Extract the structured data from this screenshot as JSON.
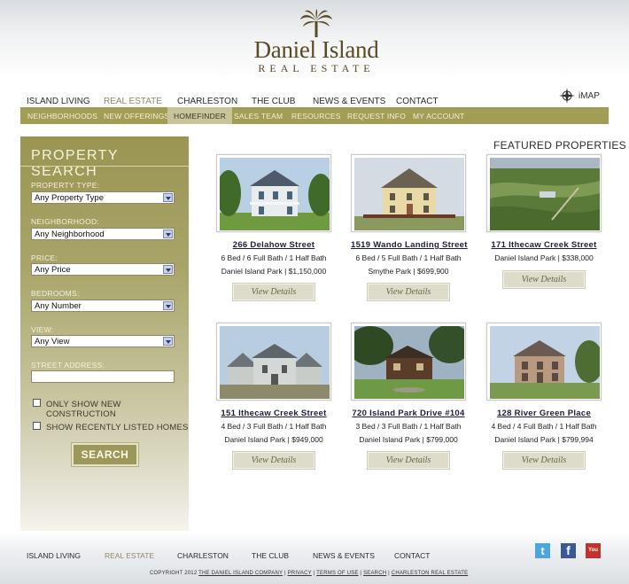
{
  "logo": {
    "name": "Daniel Island",
    "sub": "REAL ESTATE"
  },
  "top_nav": [
    {
      "label": "ISLAND LIVING",
      "active": false
    },
    {
      "label": "REAL ESTATE",
      "active": true
    },
    {
      "label": "CHARLESTON",
      "active": false
    },
    {
      "label": "THE CLUB",
      "active": false
    },
    {
      "label": "NEWS & EVENTS",
      "active": false
    },
    {
      "label": "CONTACT",
      "active": false
    }
  ],
  "imap_label": "iMAP",
  "sub_nav": [
    {
      "label": "NEIGHBORHOODS",
      "active": false
    },
    {
      "label": "NEW OFFERINGS",
      "active": false
    },
    {
      "label": "HOMEFINDER",
      "active": true
    },
    {
      "label": "SALES TEAM",
      "active": false
    },
    {
      "label": "RESOURCES",
      "active": false
    },
    {
      "label": "REQUEST INFO",
      "active": false
    },
    {
      "label": "MY ACCOUNT",
      "active": false
    }
  ],
  "search": {
    "title": "PROPERTY SEARCH",
    "fields": [
      {
        "label": "PROPERTY TYPE:",
        "value": "Any Property Type"
      },
      {
        "label": "NEIGHBORHOOD:",
        "value": "Any Neighborhood"
      },
      {
        "label": "PRICE:",
        "value": "Any Price"
      },
      {
        "label": "BEDROOMS:",
        "value": "Any Number"
      },
      {
        "label": "VIEW:",
        "value": "Any View"
      }
    ],
    "street_label": "STREET ADDRESS:",
    "street_value": "",
    "check_new": "ONLY SHOW NEW CONSTRUCTION",
    "check_recent": "SHOW RECENTLY LISTED HOMES",
    "button": "SEARCH"
  },
  "featured_title": "FEATURED PROPERTIES",
  "properties": [
    {
      "address": "266 Delahow Street",
      "specs": "6 Bed / 6 Full Bath / 1 Half Bath",
      "location_price": "Daniel Island Park | $1,150,000",
      "button": "View Details"
    },
    {
      "address": "1519 Wando Landing Street",
      "specs": "6 Bed / 5 Full Bath / 1 Half Bath",
      "location_price": "Smythe Park | $699,900",
      "button": "View Details"
    },
    {
      "address": "171 Ithecaw Creek Street",
      "specs": "",
      "location_price": "Daniel Island Park | $338,000",
      "button": "View Details"
    },
    {
      "address": "151 Ithecaw Creek Street",
      "specs": "4 Bed / 3 Full Bath / 1 Half Bath",
      "location_price": "Daniel Island Park | $949,000",
      "button": "View Details"
    },
    {
      "address": "720 Island Park Drive #104",
      "specs": "3 Bed / 3 Full Bath / 1 Half Bath",
      "location_price": "Daniel Island Park | $799,000",
      "button": "View Details"
    },
    {
      "address": "128 River Green Place",
      "specs": "4 Bed / 4 Full Bath / 1 Half Bath",
      "location_price": "Daniel Island Park | $799,994",
      "button": "View Details"
    }
  ],
  "footer_nav": [
    {
      "label": "ISLAND LIVING",
      "active": false
    },
    {
      "label": "REAL ESTATE",
      "active": true
    },
    {
      "label": "CHARLESTON",
      "active": false
    },
    {
      "label": "THE CLUB",
      "active": false
    },
    {
      "label": "NEWS & EVENTS",
      "active": false
    },
    {
      "label": "CONTACT",
      "active": false
    }
  ],
  "copyright": {
    "prefix": "COPYRIGHT 2012",
    "company": "THE DANIEL ISLAND COMPANY",
    "privacy": "PRIVACY",
    "terms": "TERMS OF USE",
    "search": "SEARCH",
    "charleston": "CHARLESTON REAL ESTATE"
  },
  "social": [
    {
      "icon": "twitter-icon",
      "glyph": "t",
      "color": "#4aa6dc"
    },
    {
      "icon": "facebook-icon",
      "glyph": "f",
      "color": "#3b5998"
    },
    {
      "icon": "youtube-icon",
      "glyph": "You",
      "color": "#c4302b"
    }
  ],
  "colors": {
    "olive": "#a29d55",
    "sidebar_top": "#9a9551",
    "brown": "#5b4a26"
  }
}
